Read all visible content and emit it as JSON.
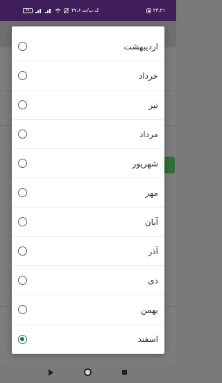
{
  "status_bar": {
    "time": "۲۳:۲۱",
    "network_speed": "۳۷.۶ ک.ب/ث",
    "battery_level": "۴۸"
  },
  "dialog": {
    "options": [
      {
        "label": "اردیبهشت",
        "selected": false
      },
      {
        "label": "خرداد",
        "selected": false
      },
      {
        "label": "تیر",
        "selected": false
      },
      {
        "label": "مرداد",
        "selected": false
      },
      {
        "label": "شهریور",
        "selected": false
      },
      {
        "label": "مهر",
        "selected": false
      },
      {
        "label": "آبان",
        "selected": false
      },
      {
        "label": "آذر",
        "selected": false
      },
      {
        "label": "دی",
        "selected": false
      },
      {
        "label": "بهمن",
        "selected": false
      },
      {
        "label": "اسفند",
        "selected": true
      }
    ]
  },
  "colors": {
    "status_bar_bg": "#3f1e59",
    "radio_selected": "#1f7a4d",
    "scrim": "#7a7a7a"
  }
}
